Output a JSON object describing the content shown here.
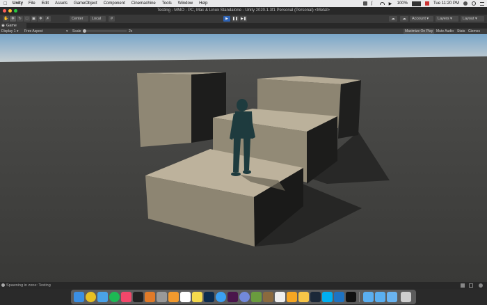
{
  "menubar": {
    "app": "Unity",
    "items": [
      "File",
      "Edit",
      "Assets",
      "GameObject",
      "Component",
      "Cinemachine",
      "Tools",
      "Window",
      "Help"
    ],
    "battery": "100%",
    "clock": "Tue 11:20 PM"
  },
  "window": {
    "title": "Testing - MMO - PC, Mac & Linux Standalone - Unity 2020.1.3f1 Personal (Personal) <Metal>"
  },
  "toolbar": {
    "pivot": "Center",
    "space": "Local",
    "account": "Account",
    "layers": "Layers",
    "layout": "Layout"
  },
  "game_tab": {
    "label": "Game"
  },
  "game_bar": {
    "display": "Display 1",
    "aspect": "Free Aspect",
    "scale_label": "Scale",
    "scale_value": "2x",
    "maximize": "Maximize On Play",
    "mute": "Mute Audio",
    "stats": "Stats",
    "gizmos": "Gizmos"
  },
  "status": {
    "message": "Spawning in zone: Testing"
  },
  "colors": {
    "play_active": "#2f64b5",
    "sky_top": "#7aa6c9",
    "ground": "#3a3a38",
    "box_top": "#bdb29c",
    "box_side": "#8d8572",
    "character": "#1e3b3e"
  },
  "dock": {
    "icons": [
      "finder-icon",
      "chrome-icon",
      "mail-icon",
      "spotify-icon",
      "music-icon",
      "terminal-icon",
      "sublime-icon",
      "unity-hub-icon",
      "books-icon",
      "calendar-icon",
      "notes-icon",
      "photoshop-icon",
      "safari-icon",
      "slack-icon",
      "discord-icon",
      "minecraft-icon",
      "chess-icon",
      "textedit-icon",
      "pages-icon",
      "scratch-icon",
      "steam-icon",
      "skype-icon",
      "vscode-icon",
      "unity-icon",
      "downloads-folder-icon",
      "documents-folder-icon",
      "applications-icon",
      "trash-icon"
    ]
  }
}
